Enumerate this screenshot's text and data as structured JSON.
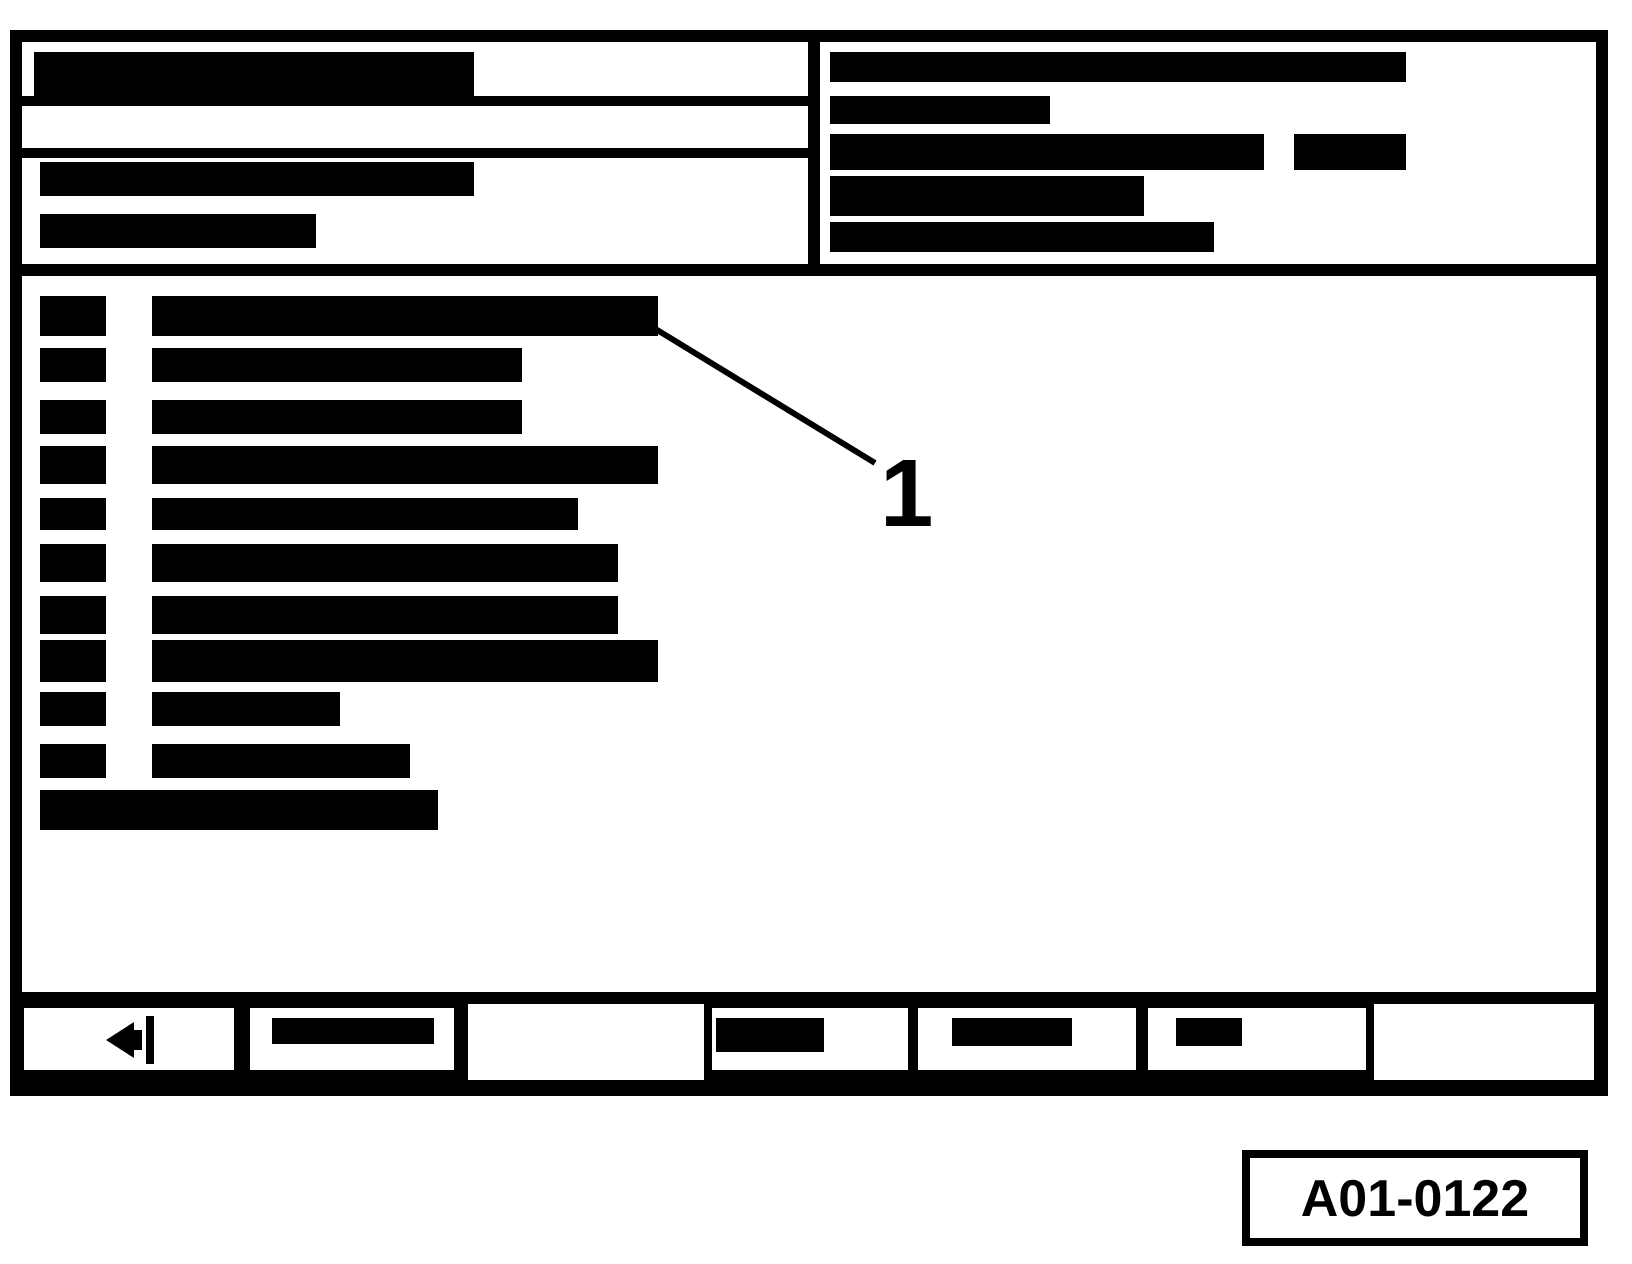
{
  "callout": {
    "label": "1"
  },
  "figure_label": "A01-0122"
}
